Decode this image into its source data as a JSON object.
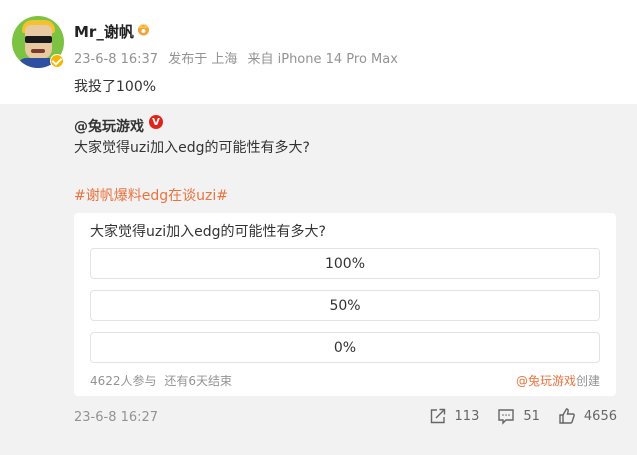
{
  "post": {
    "username": "Mr_谢帆",
    "time": "23-6-8 16:37",
    "published_from": "发布于 上海",
    "device": "来自 iPhone 14 Pro Max",
    "text": "我投了100%"
  },
  "repost": {
    "source_user": "@兔玩游戏",
    "verified_mark": "V",
    "text": "大家觉得uzi加入edg的可能性有多大?",
    "hashtag": "#谢帆爆料edg在谈uzi#",
    "vote": {
      "question": "大家觉得uzi加入edg的可能性有多大?",
      "options": [
        "100%",
        "50%",
        "0%"
      ],
      "participants": "4622人参与",
      "remaining": "还有6天结束",
      "creator": "@兔玩游戏",
      "created_label": "创建"
    },
    "time": "23-6-8 16:27",
    "actions": {
      "share_count": "113",
      "comment_count": "51",
      "like_count": "4656"
    }
  },
  "colors": {
    "accent": "#eb7340",
    "muted": "#939393",
    "background": "#f2f2f2",
    "verified_red": "#e0241b",
    "verified_gold": "#f7b500"
  }
}
